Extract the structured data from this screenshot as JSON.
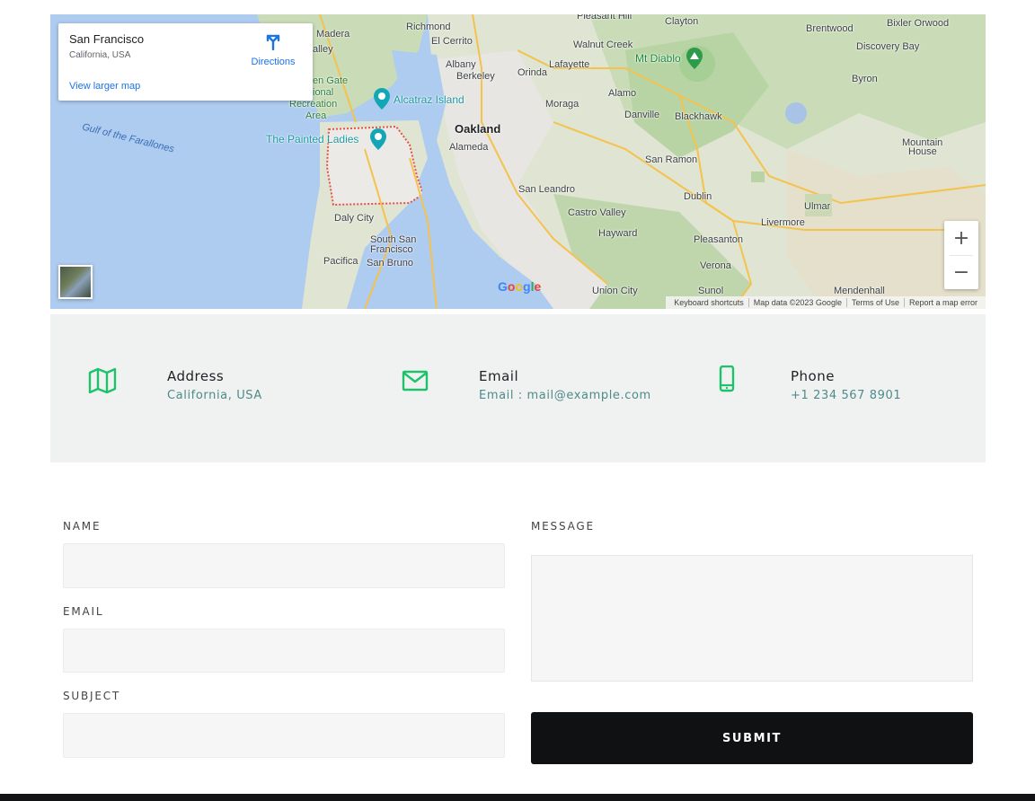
{
  "map": {
    "place_title": "San Francisco",
    "place_subtitle": "California, USA",
    "view_larger": "View larger map",
    "directions": "Directions",
    "zoom_in": "+",
    "zoom_out": "−",
    "labels": {
      "pleasant_hill": "Pleasant Hill",
      "clayton": "Clayton",
      "bixler_orwood": "Bixler Orwood",
      "brentwood": "Brentwood",
      "madera": "Madera",
      "richmond": "Richmond",
      "el_cerrito": "El Cerrito",
      "walnut_creek": "Walnut Creek",
      "mt_diablo": "Mt Diablo",
      "discovery_bay": "Discovery Bay",
      "albany": "Albany",
      "berkeley": "Berkeley",
      "orinda": "Orinda",
      "lafayette": "Lafayette",
      "byron": "Byron",
      "alamo": "Alamo",
      "alcatraz": "Alcatraz Island",
      "moraga": "Moraga",
      "golden_gate": "en Gate",
      "national": "ional",
      "recreation": "Recreation",
      "area": "Area",
      "oakland": "Oakland",
      "danville": "Danville",
      "blackhawk": "Blackhawk",
      "gulf": "Gulf of the Farallones",
      "painted_ladies": "The Painted Ladies",
      "alameda": "Alameda",
      "mountain_house": "Mountain",
      "mountain_house2": "House",
      "san_ramon": "San Ramon",
      "san_leandro": "San Leandro",
      "dublin": "Dublin",
      "ulmar": "Ulmar",
      "castro_valley": "Castro Valley",
      "livermore": "Livermore",
      "daly_city": "Daly City",
      "hayward": "Hayward",
      "pleasanton": "Pleasanton",
      "south_sf": "South San",
      "south_sf2": "Francisco",
      "pacifica": "Pacifica",
      "san_bruno": "San Bruno",
      "verona": "Verona",
      "union_city": "Union City",
      "sunol": "Sunol",
      "mendenhall": "Mendenhall",
      "valley": "alley"
    },
    "attribution": [
      "Keyboard shortcuts",
      "Map data ©2023 Google",
      "Terms of Use",
      "Report a map error"
    ],
    "google_letters": [
      "G",
      "o",
      "o",
      "g",
      "l",
      "e"
    ]
  },
  "contact": {
    "address": {
      "title": "Address",
      "value": "California, USA",
      "icon": "map-icon"
    },
    "email": {
      "title": "Email",
      "value": "Email : mail@example.com",
      "icon": "envelope-icon"
    },
    "phone": {
      "title": "Phone",
      "value": "+1 234 567 8901",
      "icon": "phone-icon"
    }
  },
  "form": {
    "name_label": "NAME",
    "email_label": "EMAIL",
    "subject_label": "SUBJECT",
    "message_label": "MESSAGE",
    "submit_label": "SUBMIT"
  },
  "colors": {
    "accent": "#1ec26a",
    "info_value": "#4f8a8b",
    "button_bg": "#0f1113",
    "band_bg": "#f0f2f1"
  }
}
